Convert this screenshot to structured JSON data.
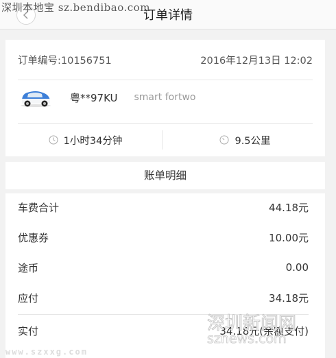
{
  "watermark_top": "深圳本地宝 sz.bendibao.com",
  "header": {
    "title": "订单详情",
    "back_icon": "back-arrow-icon"
  },
  "order": {
    "number_label": "订单编号:10156751",
    "datetime": "2016年12月13日 12:02",
    "car_plate": "粤**97KU",
    "car_model": "smart fortwo",
    "duration": "1小时34分钟",
    "distance": "9.5公里",
    "duration_icon": "clock-icon",
    "distance_icon": "gauge-icon"
  },
  "bill": {
    "title": "账单明细",
    "rows": [
      {
        "label": "车费合计",
        "value": "44.18元"
      },
      {
        "label": "优惠券",
        "value": "10.00元"
      },
      {
        "label": "途币",
        "value": "0.00"
      },
      {
        "label": "应付",
        "value": "34.18元"
      },
      {
        "label": "实付",
        "value": "34.18元(余额支付)"
      }
    ]
  },
  "watermarks": {
    "bottom_left": "www.szxxg.com",
    "logo_cn": "深圳新闻网",
    "logo_en": "sznews.com"
  },
  "colors": {
    "car_body": "#3d7fd8",
    "background": "#f2f2f2"
  }
}
